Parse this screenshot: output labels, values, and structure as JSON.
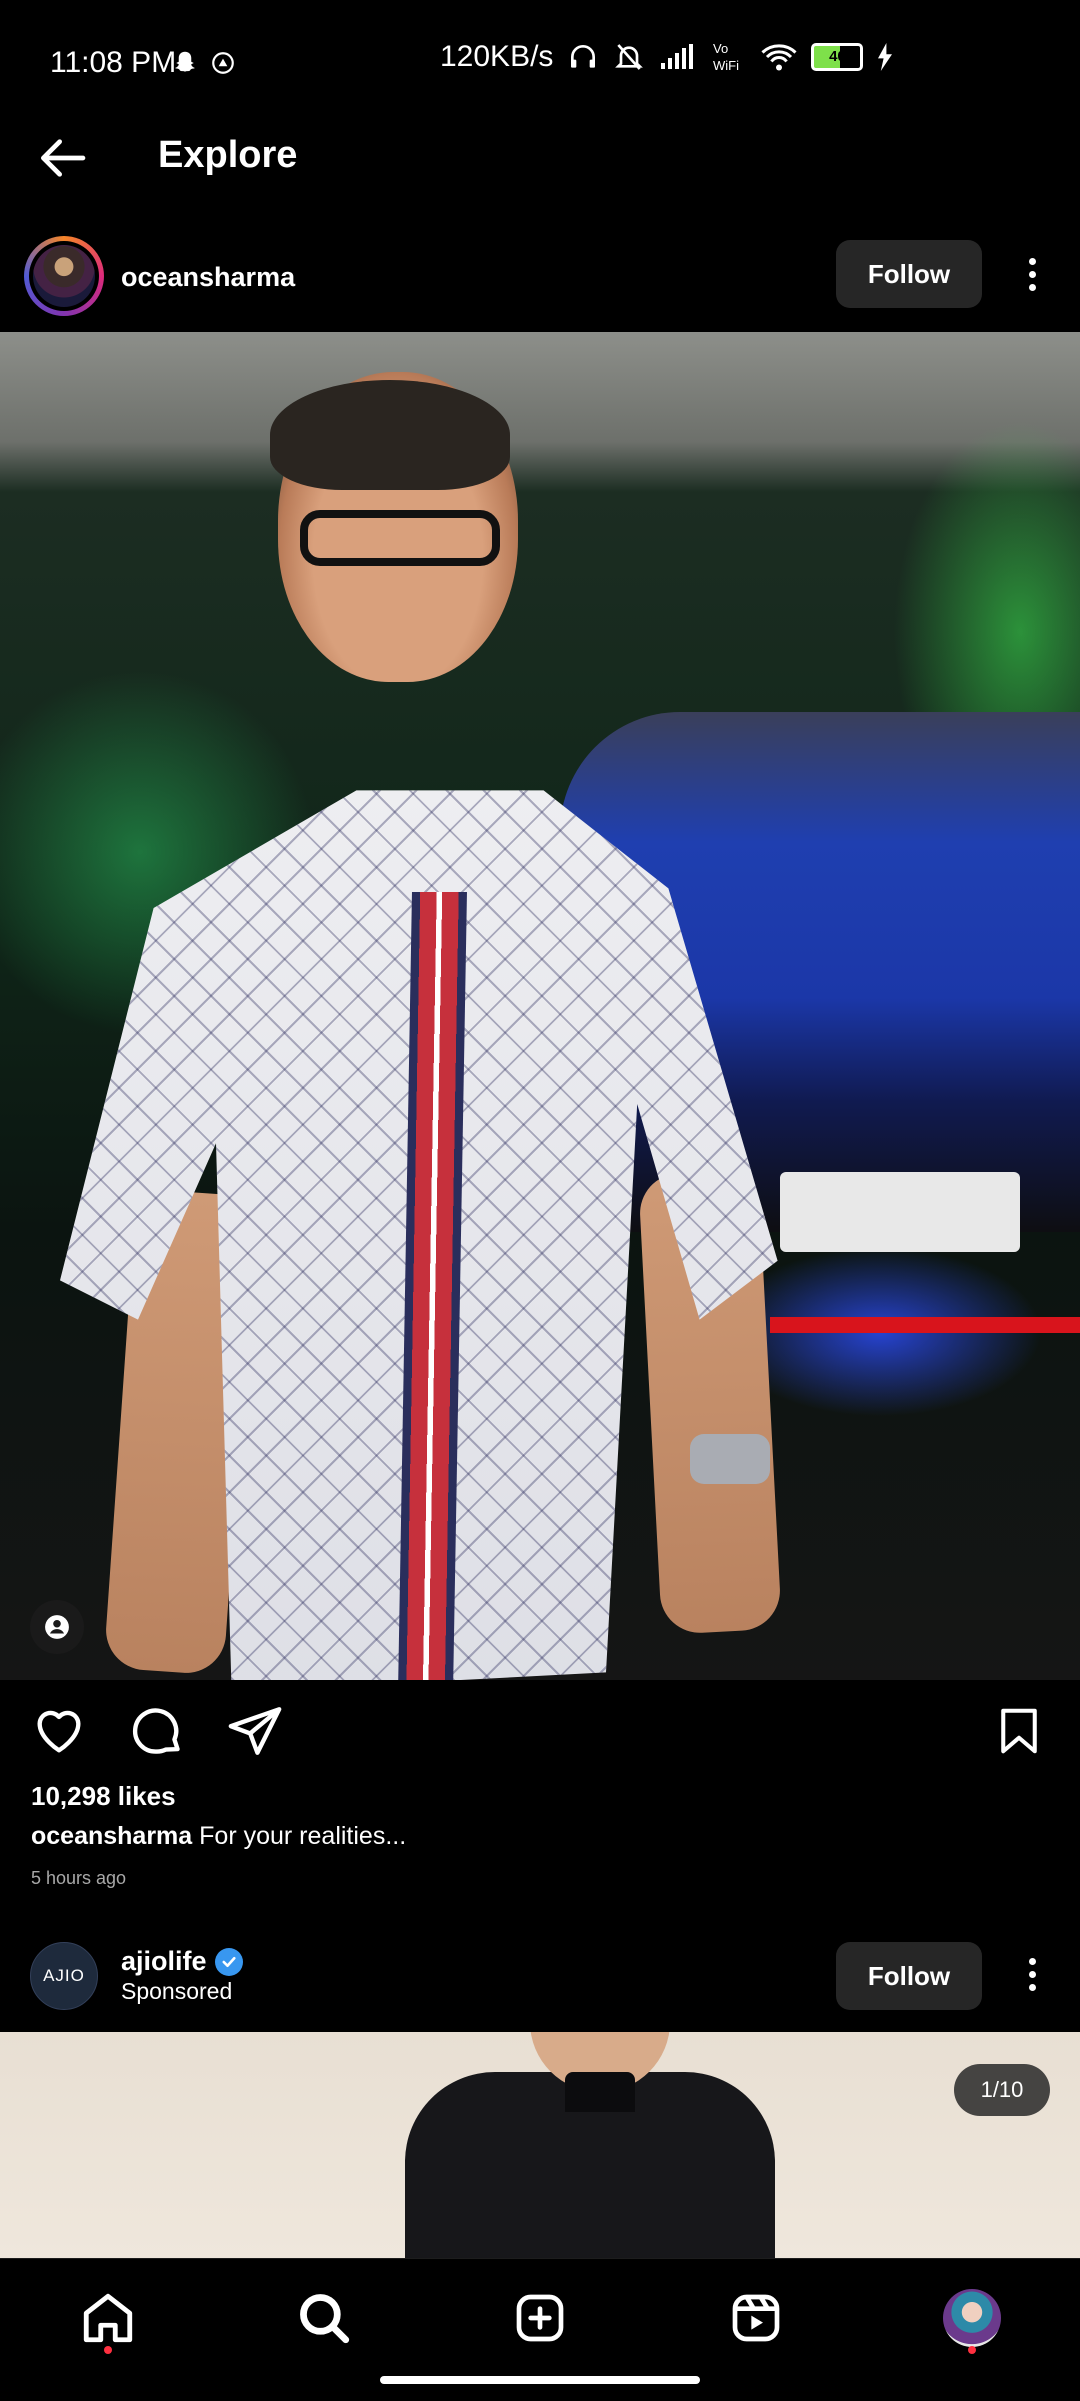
{
  "status_bar": {
    "time": "11:08 PM",
    "network_speed": "120KB/s",
    "battery": "40",
    "icons": [
      "snapchat-icon",
      "headphones-icon",
      "mute-bell-icon",
      "signal-icon",
      "volte-icon",
      "wifi-icon",
      "battery-icon",
      "charging-icon"
    ]
  },
  "header": {
    "title": "Explore",
    "back_icon": "arrow-left-icon"
  },
  "post1": {
    "username": "oceansharma",
    "follow_label": "Follow",
    "likes": "10,298 likes",
    "caption_user": "oceansharma",
    "caption_text": "For your realities...",
    "time_ago": "5 hours ago"
  },
  "post2": {
    "username": "ajiolife",
    "avatar_text": "AJIO",
    "sponsored": "Sponsored",
    "follow_label": "Follow",
    "page_counter": "1/10"
  },
  "bottom_nav": [
    "home-icon",
    "search-icon",
    "create-icon",
    "reels-icon",
    "profile-avatar"
  ],
  "colors": {
    "background": "#000000",
    "follow_button": "#262626",
    "verified": "#3897f0",
    "notification_dot": "#ff3040"
  }
}
